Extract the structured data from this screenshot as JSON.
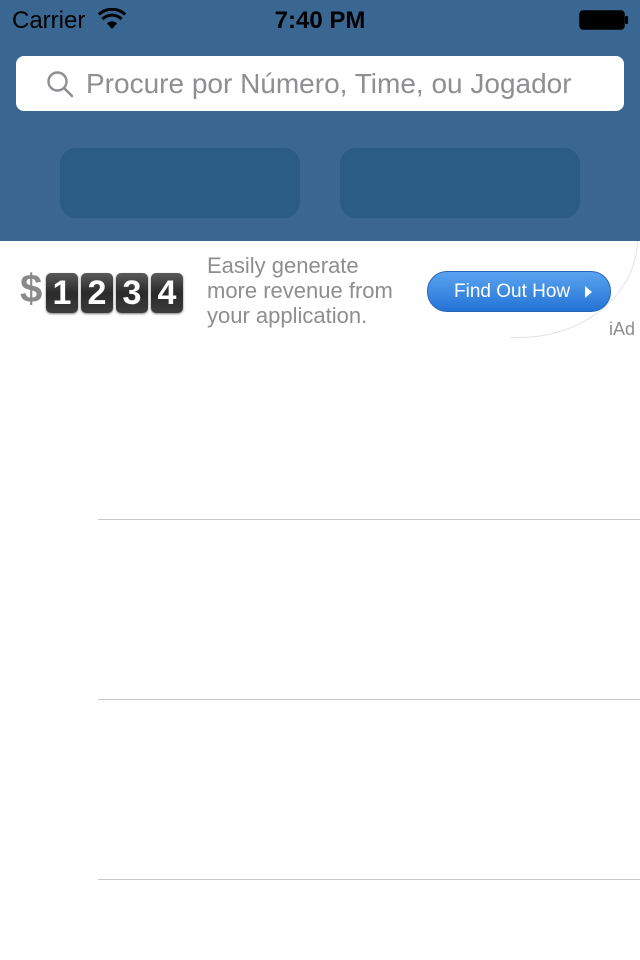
{
  "status_bar": {
    "carrier": "Carrier",
    "time": "7:40 PM",
    "wifi_icon": "wifi-icon",
    "battery_icon": "battery-icon"
  },
  "search": {
    "placeholder": "Procure por Número, Time, ou Jogador",
    "value": "",
    "icon": "search-icon"
  },
  "segment_buttons": [
    {
      "label": ""
    },
    {
      "label": ""
    }
  ],
  "ad": {
    "currency": "$",
    "digits": [
      "1",
      "2",
      "3",
      "4"
    ],
    "lines": [
      "Easily generate",
      "more revenue from",
      "your application."
    ],
    "button_label": "Find Out How",
    "badge": "iAd"
  },
  "table": {
    "rows": [
      {
        "label": ""
      },
      {
        "label": ""
      },
      {
        "label": ""
      }
    ]
  },
  "colors": {
    "header": "#3a6791",
    "segment_button": "#2b5c83",
    "ad_button": "#2f80e0"
  }
}
